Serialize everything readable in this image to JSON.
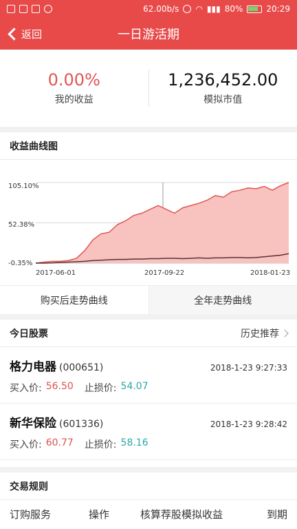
{
  "status_bar": {
    "speed": "62.00b/s",
    "battery": "80%",
    "battery_level": 0.8,
    "time": "20:29"
  },
  "nav": {
    "back_label": "返回",
    "title": "一日游活期"
  },
  "summary": {
    "return_value": "0.00%",
    "return_label": "我的收益",
    "capital_value": "1,236,452.00",
    "capital_label": "模拟市值"
  },
  "chart_section": {
    "title": "收益曲线图",
    "tabs": [
      "购买后走势曲线",
      "全年走势曲线"
    ],
    "selected_tab": 1,
    "colors": {
      "area_fill": "#f8c2bf",
      "area_line": "#e05555",
      "base_line": "#5a3030",
      "grid": "#d8d8d8"
    }
  },
  "chart_data": {
    "type": "area",
    "x_ticks": [
      "2017-06-01",
      "2017-09-22",
      "2018-01-23"
    ],
    "y_ticks": [
      "105.10%",
      "52.38%",
      "-0.35%"
    ],
    "ylim": [
      -0.35,
      105.1
    ],
    "series": [
      {
        "values": [
          -0.35,
          1,
          2,
          2,
          3,
          6,
          16,
          30,
          38,
          40,
          50,
          55,
          62,
          65,
          70,
          75,
          70,
          65,
          72,
          75,
          78,
          82,
          88,
          86,
          93,
          95,
          98,
          97,
          100,
          95,
          101,
          105.1
        ]
      },
      {
        "values": [
          -0.35,
          -0.35,
          0,
          0.5,
          1,
          1.5,
          2,
          3,
          3.5,
          4,
          4.5,
          4.5,
          5,
          5,
          5.5,
          5.5,
          6,
          6,
          5.5,
          6,
          6.5,
          6,
          6.5,
          6.5,
          7,
          7,
          6.5,
          7,
          8,
          9,
          10,
          12
        ]
      }
    ]
  },
  "stocks_section": {
    "title": "今日股票",
    "history_label": "历史推荐"
  },
  "stocks": [
    {
      "name": "格力电器",
      "code": "(000651)",
      "time": "2018-1-23 9:27:33",
      "buy_label": "买入价:",
      "buy_price": "56.50",
      "stop_label": "止损价:",
      "stop_price": "54.07"
    },
    {
      "name": "新华保险",
      "code": "(601336)",
      "time": "2018-1-23 9:28:42",
      "buy_label": "买入价:",
      "buy_price": "60.77",
      "stop_label": "止损价:",
      "stop_price": "58.16"
    }
  ],
  "rules": {
    "title": "交易规则",
    "columns": [
      "订购服务",
      "操作",
      "核算荐股模拟收益",
      "到期"
    ]
  }
}
